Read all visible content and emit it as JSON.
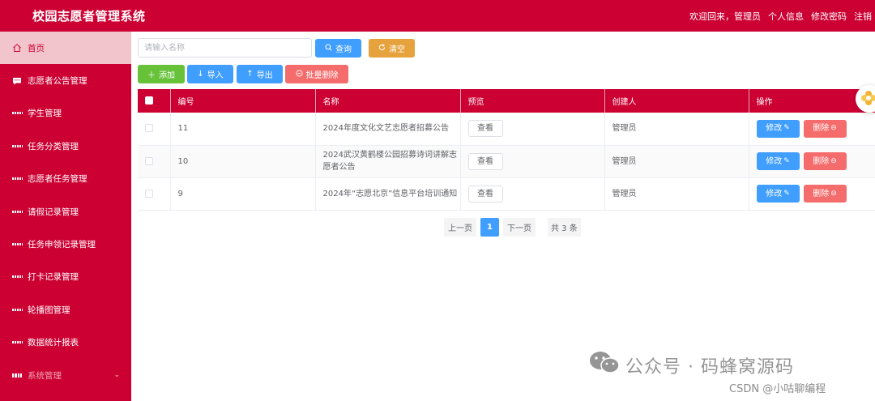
{
  "header": {
    "title": "校园志愿者管理系统",
    "welcome": "欢迎回来，管理员",
    "profile": "个人信息",
    "change_password": "修改密码",
    "logout": "注销"
  },
  "sidebar": {
    "items": [
      {
        "label": "首页",
        "icon": "home-icon",
        "active": true
      },
      {
        "label": "志愿者公告管理",
        "icon": "chat-icon"
      },
      {
        "label": "学生管理",
        "icon": "grid-icon"
      },
      {
        "label": "任务分类管理",
        "icon": "grid-icon"
      },
      {
        "label": "志愿者任务管理",
        "icon": "grid-icon"
      },
      {
        "label": "请假记录管理",
        "icon": "grid-icon"
      },
      {
        "label": "任务申领记录管理",
        "icon": "grid-icon"
      },
      {
        "label": "打卡记录管理",
        "icon": "grid-icon"
      },
      {
        "label": "轮播图管理",
        "icon": "grid-icon"
      },
      {
        "label": "数据统计报表",
        "icon": "grid-icon"
      },
      {
        "label": "系统管理",
        "icon": "apps-icon"
      }
    ]
  },
  "search": {
    "placeholder": "请输入名称",
    "query_label": "查询",
    "clear_label": "清空"
  },
  "toolbar": {
    "add_label": "添加",
    "import_label": "导入",
    "export_label": "导出",
    "batch_delete_label": "批量删除"
  },
  "table": {
    "columns": [
      "编号",
      "名称",
      "预览",
      "创建人",
      "操作"
    ],
    "rows": [
      {
        "id": "11",
        "name": "2024年度文化文艺志愿者招募公告",
        "preview": "查看",
        "creator": "管理员",
        "edit": "修改",
        "delete": "删除"
      },
      {
        "id": "10",
        "name": "2024武汉黄鹤楼公园招募诗词讲解志愿者公告",
        "preview": "查看",
        "creator": "管理员",
        "edit": "修改",
        "delete": "删除"
      },
      {
        "id": "9",
        "name": "2024年“志愿北京”信息平台培训通知",
        "preview": "查看",
        "creator": "管理员",
        "edit": "修改",
        "delete": "删除"
      }
    ]
  },
  "pagination": {
    "prev": "上一页",
    "current": "1",
    "next": "下一页",
    "total": "共 3 条"
  },
  "watermark": {
    "main": "公众号 · 码蜂窝源码",
    "sub": "CSDN @小咕聊编程"
  },
  "colors": {
    "brand": "#cc0033",
    "primary": "#409eff",
    "warning": "#e6a23c",
    "success": "#67c23a",
    "danger": "#f56c6c"
  }
}
